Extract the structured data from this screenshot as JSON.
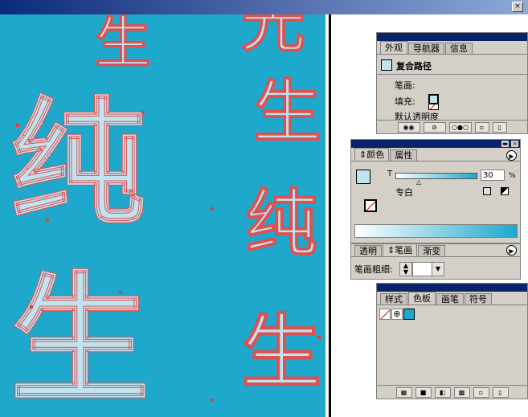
{
  "window": {
    "close_symbol": "×"
  },
  "canvas": {
    "background": "#1ea8cc",
    "glyphs": [
      {
        "char": "生",
        "role": "top-small"
      },
      {
        "char": "纯",
        "role": "left-large"
      },
      {
        "char": "生",
        "role": "bottom-large"
      },
      {
        "char": "光",
        "role": "right-top"
      },
      {
        "char": "生",
        "role": "right-mid"
      },
      {
        "char": "纯",
        "role": "right-lower"
      },
      {
        "char": "生",
        "role": "right-bottom"
      }
    ]
  },
  "appearance_panel": {
    "tabs": [
      "外观",
      "导航器",
      "信息"
    ],
    "active_tab": 0,
    "item_title": "复合路径",
    "stroke_label": "笔画:",
    "fill_label": "填充:",
    "opacity_label": "默认透明度",
    "bottom_buttons": [
      "new-art-icon",
      "clear-icon",
      "reduce-icon",
      "duplicate-icon",
      "delete-icon"
    ]
  },
  "color_panel": {
    "tabs": [
      "颜色",
      "属性"
    ],
    "active_tab": 0,
    "slider_letter": "T",
    "tint_value": "30",
    "tint_unit": "%",
    "tint_fraction": 0.3,
    "spot_label": "专白",
    "fill_color": "#bfe3ef",
    "ramp_end_color": "#1ea8cc"
  },
  "stroke_panel": {
    "tabs": [
      "透明",
      "笔画",
      "渐变"
    ],
    "active_tab": 1,
    "weight_label": "笔画粗细:",
    "weight_value": ""
  },
  "swatches_panel": {
    "tabs": [
      "样式",
      "色板",
      "画笔",
      "符号"
    ],
    "active_tab": 1,
    "swatches": [
      "none",
      "registration",
      "#1ea8cc"
    ],
    "bottom_buttons": [
      "show-kinds-icon",
      "color-swatch-icon",
      "gradient-swatch-icon",
      "pattern-swatch-icon",
      "new-swatch-icon",
      "delete-icon"
    ]
  }
}
